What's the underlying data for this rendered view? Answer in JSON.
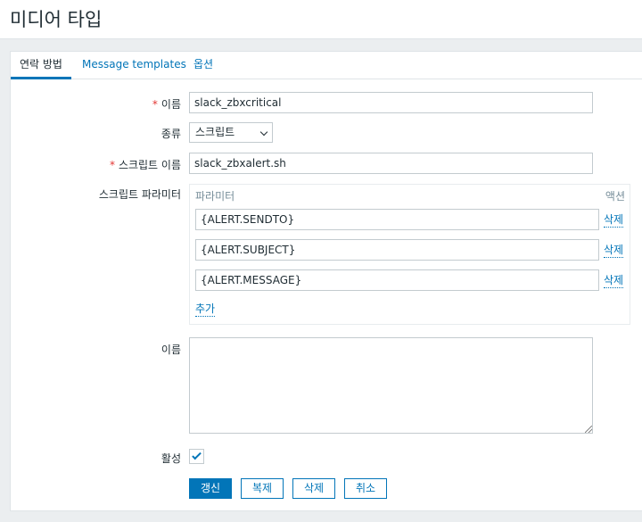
{
  "page": {
    "title": "미디어 타입"
  },
  "tabs": [
    {
      "label": "연락 방법"
    },
    {
      "label": "Message templates"
    },
    {
      "label": "옵션"
    }
  ],
  "form": {
    "name_label": "이름",
    "name_value": "slack_zbxcritical",
    "type_label": "종류",
    "type_value": "스크립트",
    "script_name_label": "스크립트 이름",
    "script_name_value": "slack_zbxalert.sh",
    "params_label": "스크립트 파라미터",
    "params": {
      "col_param": "파라미터",
      "col_action": "액션",
      "rows": [
        {
          "value": "{ALERT.SENDTO}",
          "remove": "삭제"
        },
        {
          "value": "{ALERT.SUBJECT}",
          "remove": "삭제"
        },
        {
          "value": "{ALERT.MESSAGE}",
          "remove": "삭제"
        }
      ],
      "add_label": "추가"
    },
    "description_label": "이름",
    "description_value": "",
    "enabled_label": "활성",
    "enabled": true
  },
  "buttons": {
    "update": "갱신",
    "clone": "복제",
    "delete": "삭제",
    "cancel": "취소"
  },
  "colors": {
    "accent": "#0275b8",
    "required": "#e33734",
    "background": "#ebeef0"
  }
}
